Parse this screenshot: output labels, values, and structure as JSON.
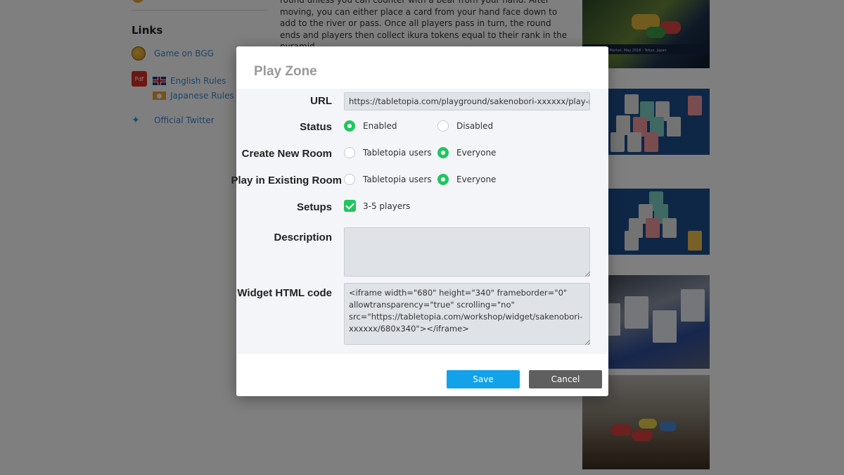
{
  "background": {
    "sidebar": {
      "links_title": "Links",
      "links": [
        {
          "label": "Game on BGG",
          "icon": "bgg-icon"
        },
        {
          "label": "English Rules",
          "icon": "uk-flag-icon"
        },
        {
          "label": "Japanese Rules",
          "icon": "japan-flag-icon"
        },
        {
          "label": "Official Twitter",
          "icon": "twitter-icon"
        }
      ],
      "pdf_badge": "Pdf"
    },
    "article_text": "round unless you can counter with a bear from your hand. After moving, you can either place a card from your hand face down to add to the river or pass. Once all players pass in turn, the round ends and players then collect ikura tokens equal to their rank in the pyramid.",
    "thumb_caption": "Game Market, May 2018 - Tokyo, Japan"
  },
  "modal": {
    "title": "Play Zone",
    "url": {
      "label": "URL",
      "value": "https://tabletopia.com/playground/sakenobori-xxxxxx/play-now"
    },
    "status": {
      "label": "Status",
      "options": [
        {
          "label": "Enabled",
          "selected": true
        },
        {
          "label": "Disabled",
          "selected": false
        }
      ]
    },
    "create_room": {
      "label": "Create New Room",
      "options": [
        {
          "label": "Tabletopia users",
          "selected": false
        },
        {
          "label": "Everyone",
          "selected": true
        }
      ]
    },
    "existing_room": {
      "label": "Play in Existing Room",
      "options": [
        {
          "label": "Tabletopia users",
          "selected": false
        },
        {
          "label": "Everyone",
          "selected": true
        }
      ]
    },
    "setups": {
      "label": "Setups",
      "option": "3-5 players",
      "checked": true
    },
    "description": {
      "label": "Description",
      "value": ""
    },
    "widget": {
      "label": "Widget HTML code",
      "value": "<iframe width=\"680\" height=\"340\" frameborder=\"0\" allowtransparency=\"true\" scrolling=\"no\" src=\"https://tabletopia.com/workshop/widget/sakenobori-xxxxxx/680x340\"></iframe>"
    },
    "save_label": "Save",
    "cancel_label": "Cancel"
  },
  "colors": {
    "accent_green": "#22c55e",
    "save_blue": "#11a2ea",
    "cancel_gray": "#5f5f5f"
  }
}
